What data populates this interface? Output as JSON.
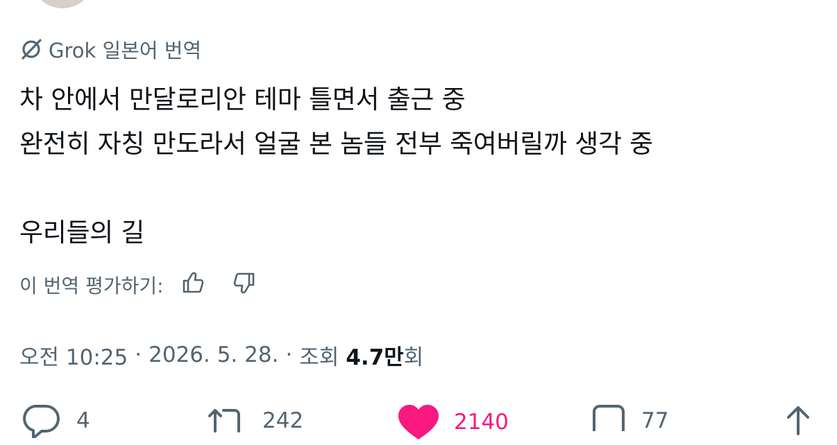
{
  "grok": {
    "label": "Grok 일본어 번역"
  },
  "tweet": {
    "lines": [
      "차 안에서 만달로리안 테마 틀면서 출근 중",
      "완전히 자칭 만도라서 얼굴 본 놈들 전부 죽여버릴까 생각 중",
      "",
      "우리들의 길"
    ]
  },
  "rating": {
    "label": "이 번역 평가하기:"
  },
  "meta": {
    "time": "오전 10:25",
    "date": "2026. 5. 28.",
    "separator": "·",
    "views_prefix": "조회",
    "views_count": "4.7만",
    "views_suffix": "회"
  },
  "actions": {
    "replies": "4",
    "reposts": "242",
    "likes": "2140",
    "bookmarks": "77"
  },
  "colors": {
    "text": "#0f1419",
    "secondary": "#536471",
    "like": "#f91880"
  },
  "icons": [
    "grok-icon",
    "thumbs-up-icon",
    "thumbs-down-icon",
    "reply-icon",
    "repost-icon",
    "heart-icon",
    "bookmark-icon",
    "share-icon"
  ]
}
